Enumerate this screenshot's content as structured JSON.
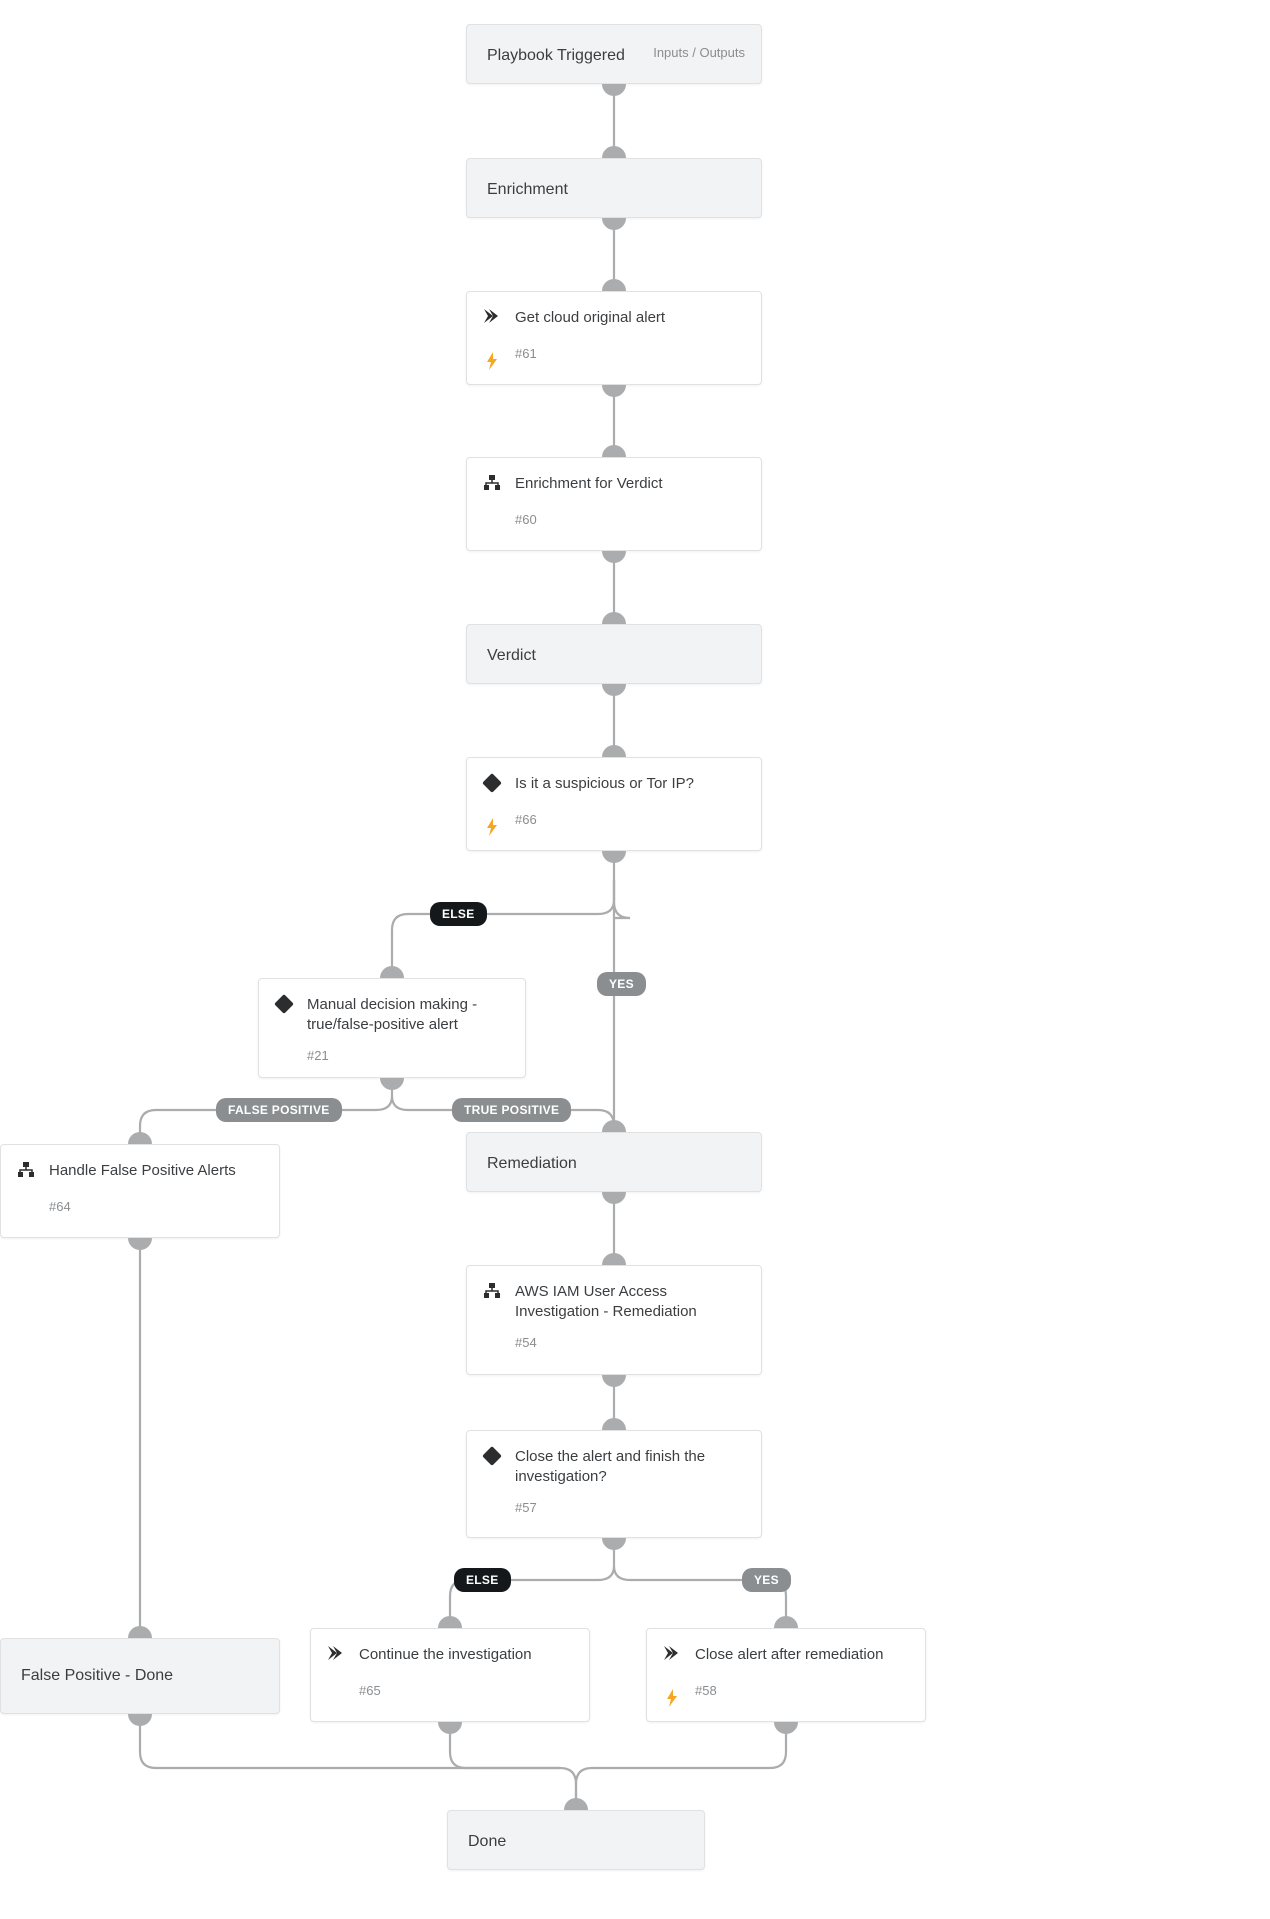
{
  "nodes": {
    "trigger": {
      "title": "Playbook Triggered",
      "io": "Inputs / Outputs"
    },
    "enrichment": {
      "title": "Enrichment"
    },
    "get_alert": {
      "title": "Get cloud original alert",
      "id": "#61"
    },
    "enrich_verdict": {
      "title": "Enrichment for Verdict",
      "id": "#60"
    },
    "verdict": {
      "title": "Verdict"
    },
    "suspicious": {
      "title": "Is it a suspicious or Tor IP?",
      "id": "#66"
    },
    "manual": {
      "title": "Manual decision making - true/false-positive alert",
      "id": "#21"
    },
    "handle_fp": {
      "title": "Handle False Positive Alerts",
      "id": "#64"
    },
    "remediation": {
      "title": "Remediation"
    },
    "aws": {
      "title": "AWS IAM User Access Investigation - Remediation",
      "id": "#54"
    },
    "close_q": {
      "title": "Close the alert and finish the investigation?",
      "id": "#57"
    },
    "continue": {
      "title": "Continue the investigation",
      "id": "#65"
    },
    "close_after": {
      "title": "Close alert after remediation",
      "id": "#58"
    },
    "fp_done": {
      "title": "False Positive - Done"
    },
    "done": {
      "title": "Done"
    }
  },
  "labels": {
    "else": "ELSE",
    "yes": "YES",
    "false_positive": "FALSE POSITIVE",
    "true_positive": "TRUE POSITIVE"
  }
}
